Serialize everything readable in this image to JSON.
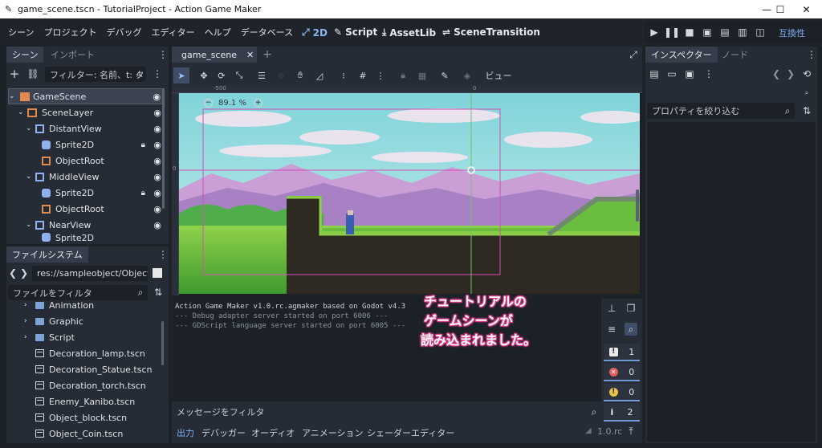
{
  "window": {
    "title": "game_scene.tscn - TutorialProject - Action Game Maker",
    "min": "—",
    "max": "☐",
    "close": "✕"
  },
  "menu": {
    "items": [
      "シーン",
      "プロジェクト",
      "デバッグ",
      "エディター",
      "ヘルプ",
      "データベース"
    ]
  },
  "modes": {
    "m2d": "2D",
    "script": "Script",
    "assetlib": "AssetLib",
    "scenetransition": "SceneTransition"
  },
  "renderer": "互換性",
  "scene_dock": {
    "tab_scene": "シーン",
    "tab_import": "インポート",
    "filter_placeholder": "フィルター: 名前、t: タ",
    "nodes": [
      {
        "label": "GameScene"
      },
      {
        "label": "SceneLayer"
      },
      {
        "label": "DistantView"
      },
      {
        "label": "Sprite2D"
      },
      {
        "label": "ObjectRoot"
      },
      {
        "label": "MiddleView"
      },
      {
        "label": "Sprite2D"
      },
      {
        "label": "ObjectRoot"
      },
      {
        "label": "NearView"
      },
      {
        "label": "Sprite2D"
      }
    ]
  },
  "filesystem": {
    "tab": "ファイルシステム",
    "path": "res://sampleobject/Object_Sa",
    "filter_placeholder": "ファイルをフィルタ",
    "items": [
      {
        "label": "Animation",
        "kind": "folder"
      },
      {
        "label": "Graphic",
        "kind": "folder"
      },
      {
        "label": "Script",
        "kind": "folder"
      },
      {
        "label": "Decoration_lamp.tscn",
        "kind": "file"
      },
      {
        "label": "Decoration_Statue.tscn",
        "kind": "file"
      },
      {
        "label": "Decoration_torch.tscn",
        "kind": "file"
      },
      {
        "label": "Enemy_Kanibo.tscn",
        "kind": "file"
      },
      {
        "label": "Object_block.tscn",
        "kind": "file"
      },
      {
        "label": "Object_Coin.tscn",
        "kind": "file"
      }
    ]
  },
  "viewport": {
    "scene_tab": "game_scene",
    "add_tab": "+",
    "view_menu": "ビュー",
    "zoom": "89.1 %",
    "ruler_labels": [
      "-500",
      "0"
    ],
    "ruler_side": "0"
  },
  "output": {
    "lines": [
      "Action Game Maker v1.0.rc.agmaker based on Godot v4.3",
      "--- Debug adapter server started on port 6006 ---",
      "--- GDScript language server started on port 6005 ---"
    ],
    "filter_placeholder": "メッセージをフィルタ",
    "counters": [
      {
        "icon": "!",
        "value": "1",
        "color": "#e9e9e9"
      },
      {
        "icon": "✕",
        "value": "0",
        "color": "#e0605f"
      },
      {
        "icon": "!",
        "value": "0",
        "color": "#e8c547"
      },
      {
        "icon": "i",
        "value": "2",
        "color": "#e9e9e9"
      }
    ],
    "bottom_tabs": [
      "出力",
      "デバッガー",
      "オーディオ",
      "アニメーション",
      "シェーダーエディター"
    ],
    "version": "1.0.rc"
  },
  "annotation": {
    "line1": "チュートリアルの",
    "line2": "ゲームシーンが",
    "line3": "読み込まれました。"
  },
  "inspector": {
    "tab_inspector": "インスペクター",
    "tab_node": "ノード",
    "filter_placeholder": "プロパティを絞り込む"
  }
}
